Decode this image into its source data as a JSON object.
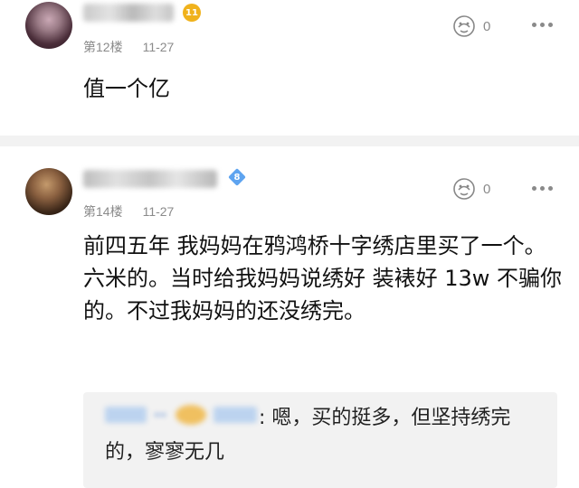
{
  "posts": [
    {
      "level_badge": "11",
      "floor": "第12楼",
      "date": "11-27",
      "likes": "0",
      "content": "值一个亿",
      "icons": {
        "like": "like-icon",
        "more": "more-icon"
      }
    },
    {
      "level_badge": "8",
      "floor": "第14楼",
      "date": "11-27",
      "likes": "0",
      "content": "前四五年 我妈妈在鸦鸿桥十字绣店里买了一个。六米的。当时给我妈妈说绣好 装裱好 13w 不骗你的。不过我妈妈的还没绣完。",
      "reply": {
        "text": ": 嗯，买的挺多，但坚持绣完的，寥寥无几"
      }
    }
  ],
  "colors": {
    "meta_gray": "#8a8a8a",
    "badge_orange": "#f0b21c",
    "badge_blue": "#5ea4f0",
    "reply_bg": "#f2f2f2"
  }
}
